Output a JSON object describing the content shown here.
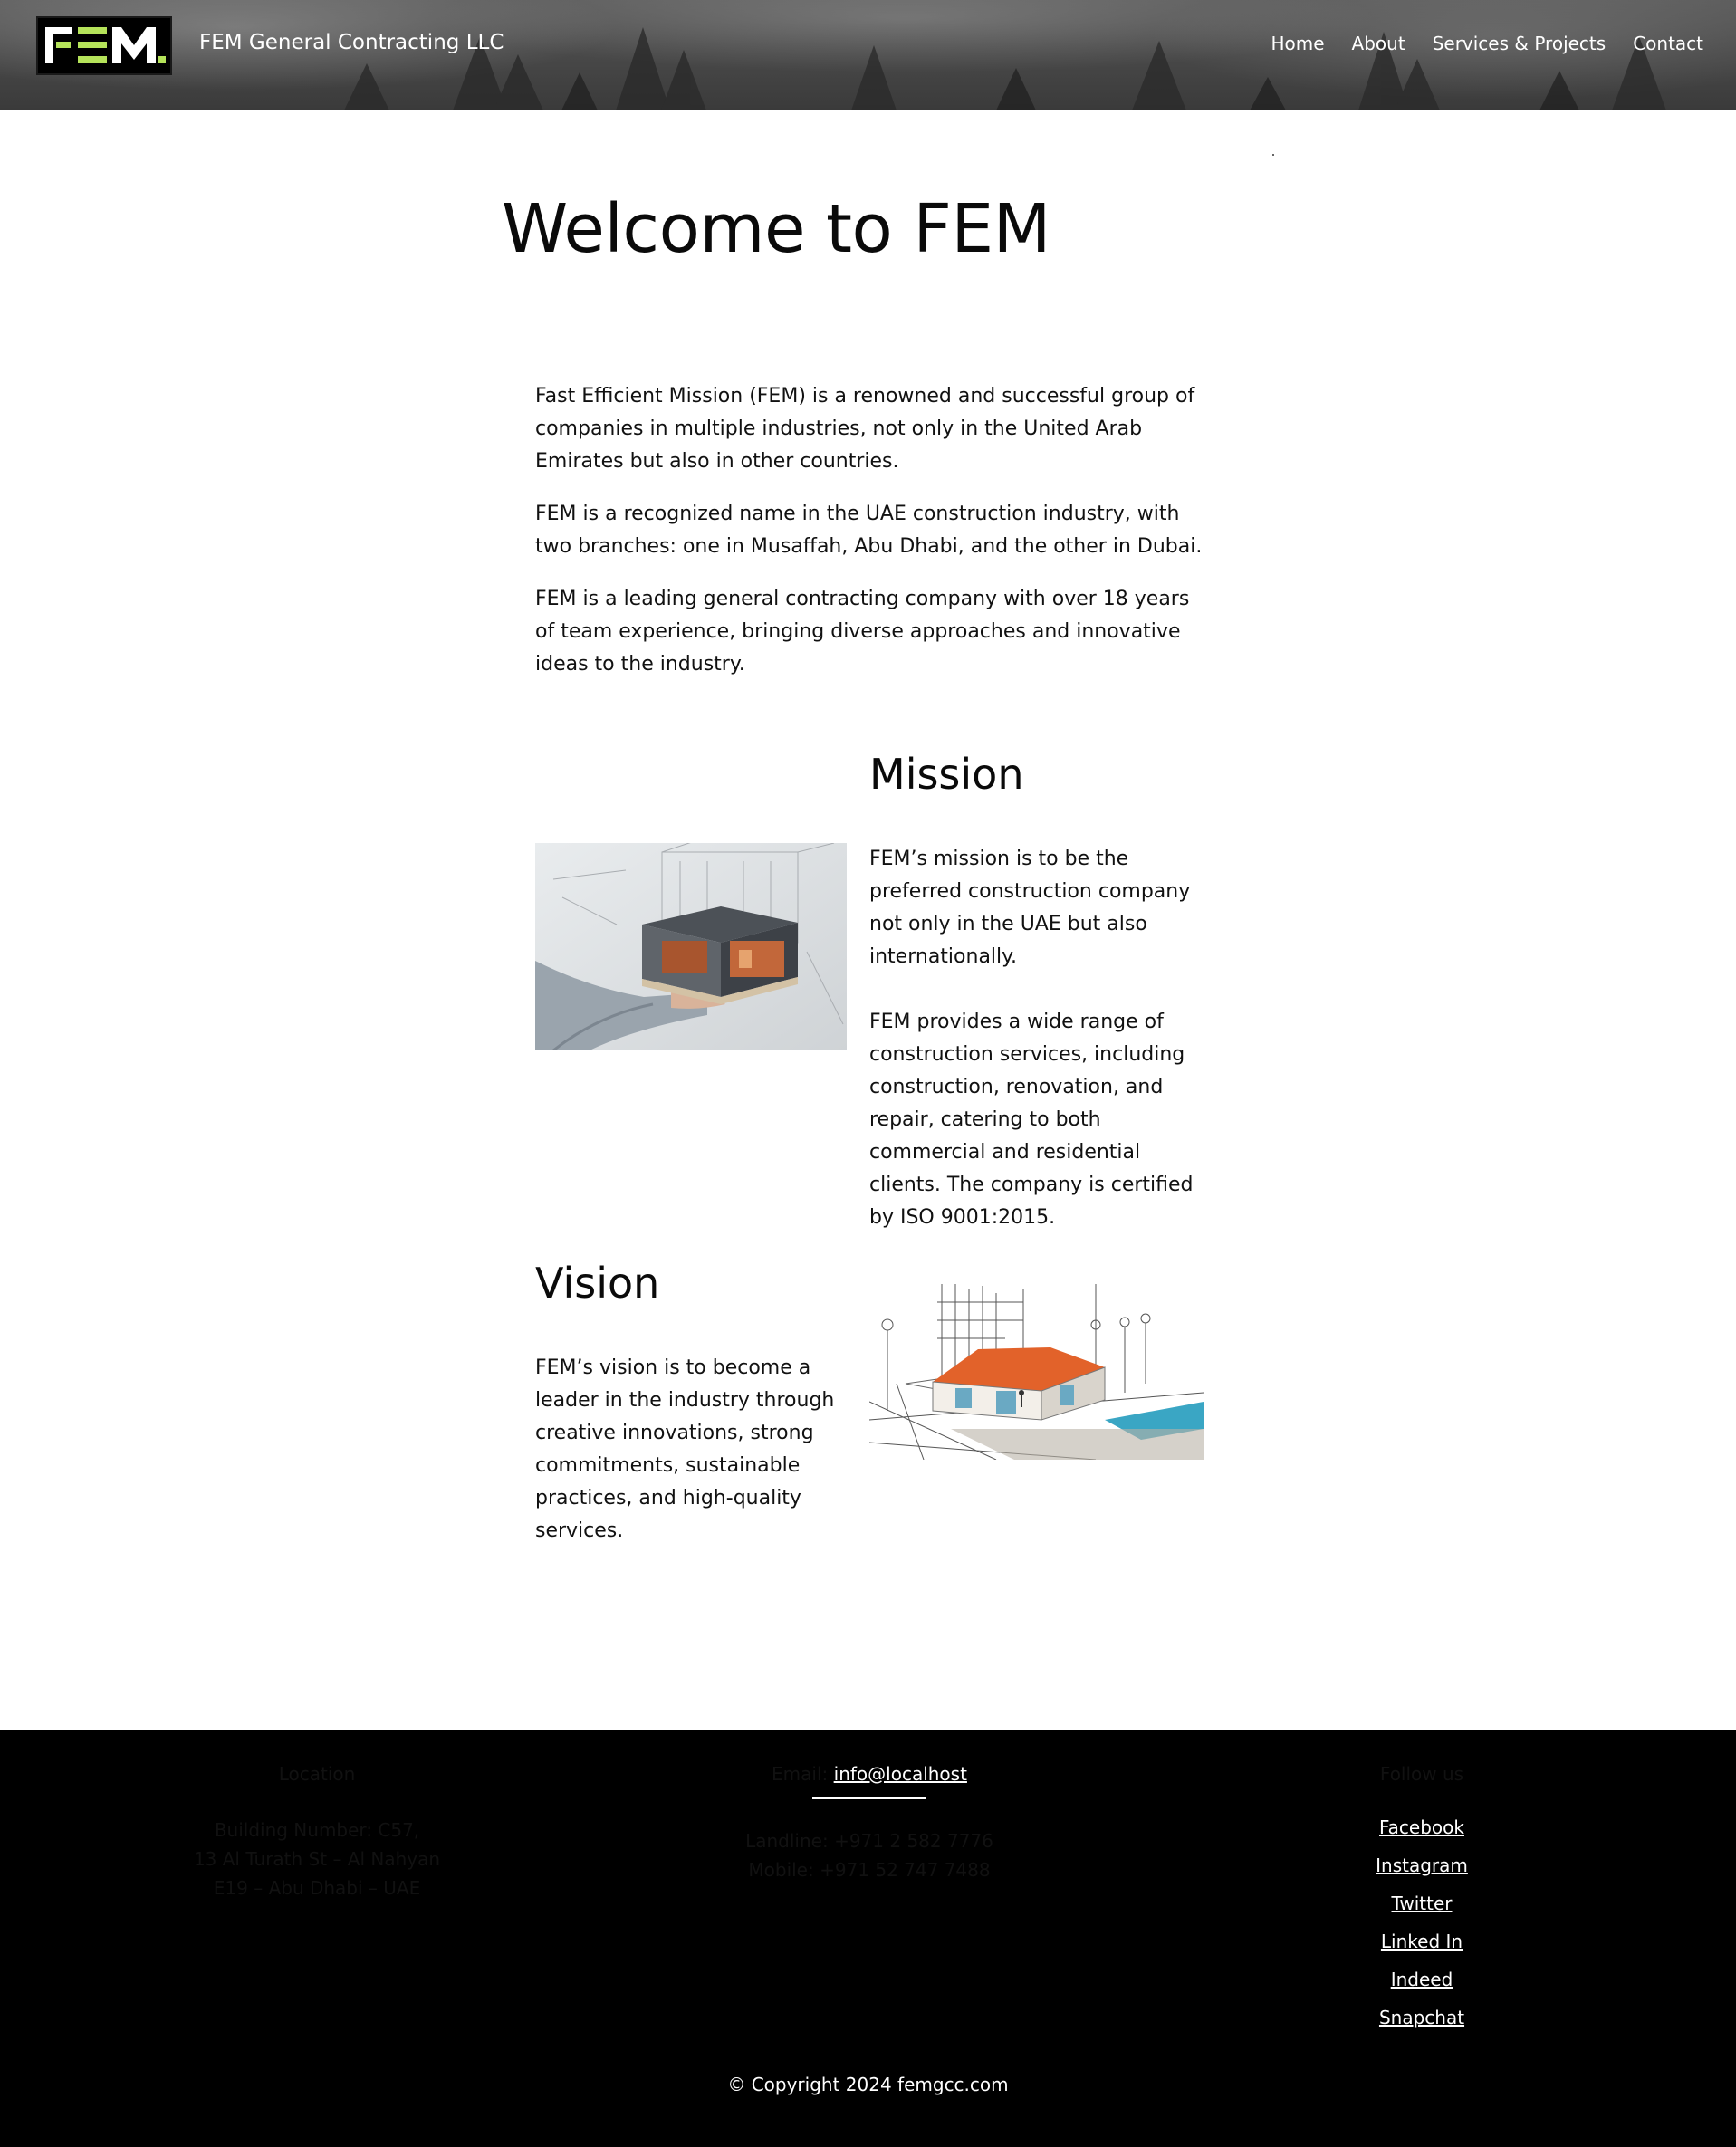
{
  "header": {
    "brand": "FEM General Contracting LLC",
    "logo_text": "FEM",
    "nav": [
      "Home",
      "About",
      "Services & Projects",
      "Contact"
    ]
  },
  "main": {
    "title": "Welcome to FEM",
    "intro": [
      "Fast Efficient Mission (FEM) is a renowned and successful group of companies in multiple industries, not only in the United Arab Emirates but also in other countries.",
      "FEM is a recognized name in the UAE construction industry, with two branches: one in Musaffah, Abu Dhabi, and the other in Dubai.",
      "FEM is a leading general contracting company with over 18 years of team experience, bringing diverse approaches and innovative ideas to the industry."
    ],
    "mission": {
      "title": "Mission",
      "paragraphs": [
        "FEM’s mission is to be the preferred construction company not only in the UAE but also internationally.",
        "FEM provides a wide range of construction services, including construction, renovation, and repair, catering to both commercial and residential clients. The company is certified by ISO 9001:2015."
      ]
    },
    "vision": {
      "title": "Vision",
      "paragraph": "FEM’s vision is to become a leader in the industry through creative innovations, strong commitments, sustainable practices, and high-quality services."
    }
  },
  "footer": {
    "location": {
      "heading": "Location",
      "lines": [
        "Building Number: C57,",
        "13 Al Turath St – Al Nahyan",
        "E19 – Abu Dhabi – UAE"
      ]
    },
    "contact": {
      "email_label": "Email: ",
      "email": "info@localhost",
      "landline": "Landline: +971 2 582 7776",
      "mobile": "Mobile: +971 52 747 7488"
    },
    "follow": {
      "heading": "Follow us",
      "links": [
        "Facebook",
        "Instagram",
        "Twitter",
        "Linked In",
        "Indeed",
        "Snapchat"
      ]
    },
    "copyright": "© Copyright 2024 femgcc.com"
  },
  "colors": {
    "logo_accent": "#b5e35a",
    "footer_bg": "#000000",
    "accent_roof": "#e2622a",
    "pool": "#3aa6c4"
  }
}
